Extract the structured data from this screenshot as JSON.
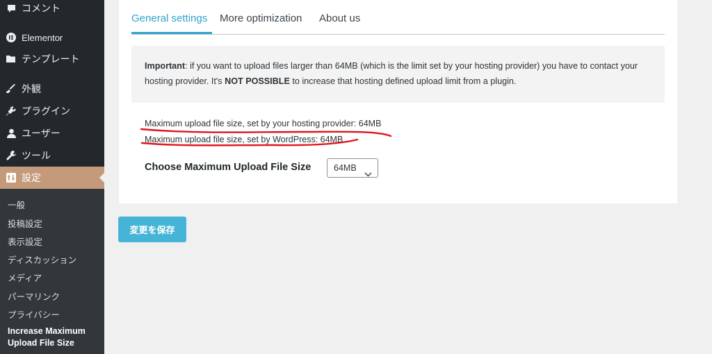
{
  "sidebar": {
    "items": [
      {
        "label": "コメント",
        "icon": "comment-icon"
      },
      {
        "label": "Elementor",
        "icon": "elementor-icon"
      },
      {
        "label": "テンプレート",
        "icon": "folder-icon"
      },
      {
        "label": "外観",
        "icon": "paintbrush-icon"
      },
      {
        "label": "プラグイン",
        "icon": "plugin-icon"
      },
      {
        "label": "ユーザー",
        "icon": "user-icon"
      },
      {
        "label": "ツール",
        "icon": "wrench-icon"
      },
      {
        "label": "設定",
        "icon": "settings-icon",
        "active": true
      }
    ],
    "submenu": [
      "一般",
      "投稿設定",
      "表示設定",
      "ディスカッション",
      "メディア",
      "パーマリンク",
      "プライバシー"
    ],
    "current_submenu": [
      "Increase Maximum",
      "Upload File Size"
    ]
  },
  "tabs": [
    {
      "label": "General settings",
      "active": true
    },
    {
      "label": "More optimization"
    },
    {
      "label": "About us"
    }
  ],
  "notice": {
    "strong": "Important",
    "text1": ": if you want to upload files larger than 64MB (which is the limit set by your hosting provider) you have to contact your hosting provider. It's ",
    "strong2": "NOT POSSIBLE",
    "text2": " to increase that hosting defined upload limit from a plugin."
  },
  "info": {
    "hosting": "Maximum upload file size, set by your hosting provider: 64MB",
    "wordpress": "Maximum upload file size, set by WordPress: 64MB"
  },
  "form": {
    "label": "Choose Maximum Upload File Size",
    "selected": "64MB"
  },
  "save_button": "変更を保存",
  "colors": {
    "accent": "#2ea2cc",
    "active_menu": "#c49a7a",
    "annotation": "#e0141e",
    "button": "#46b4d6"
  }
}
